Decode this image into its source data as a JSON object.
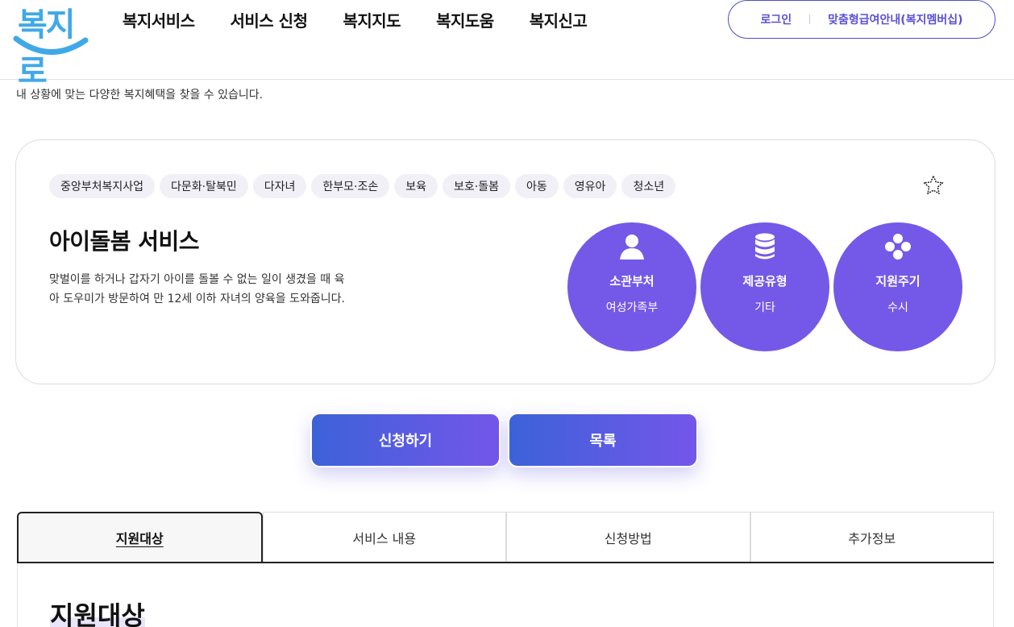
{
  "logo": {
    "text": "복지로"
  },
  "gnb": [
    "복지서비스",
    "서비스 신청",
    "복지지도",
    "복지도움",
    "복지신고"
  ],
  "util": {
    "login": "로그인",
    "membership": "맞춤형급여안내(복지멤버십)"
  },
  "intro": "내 상황에 맞는 다양한 복지혜택을 찾을 수 있습니다.",
  "card": {
    "tags": [
      "중앙부처복지사업",
      "다문화·탈북민",
      "다자녀",
      "한부모·조손",
      "보육",
      "보호·돌봄",
      "아동",
      "영유아",
      "청소년"
    ],
    "title": "아이돌봄 서비스",
    "description": "맞벌이를 하거나 갑자기 아이를 돌볼 수 없는 일이 생겼을 때 육아 도우미가 방문하여 만 12세 이하 자녀의 양육을 도와줍니다.",
    "info": [
      {
        "label": "소관부처",
        "value": "여성가족부",
        "icon": "person-icon"
      },
      {
        "label": "제공유형",
        "value": "기타",
        "icon": "database-icon"
      },
      {
        "label": "지원주기",
        "value": "수시",
        "icon": "dots-icon"
      }
    ]
  },
  "buttons": {
    "apply": "신청하기",
    "list": "목록"
  },
  "tabs": [
    "지원대상",
    "서비스 내용",
    "신청방법",
    "추가정보"
  ],
  "section": {
    "title": "지원대상"
  },
  "colors": {
    "brand": "#7459e8",
    "accent_blue": "#3c62d8",
    "logo": "#3fa9e8"
  }
}
